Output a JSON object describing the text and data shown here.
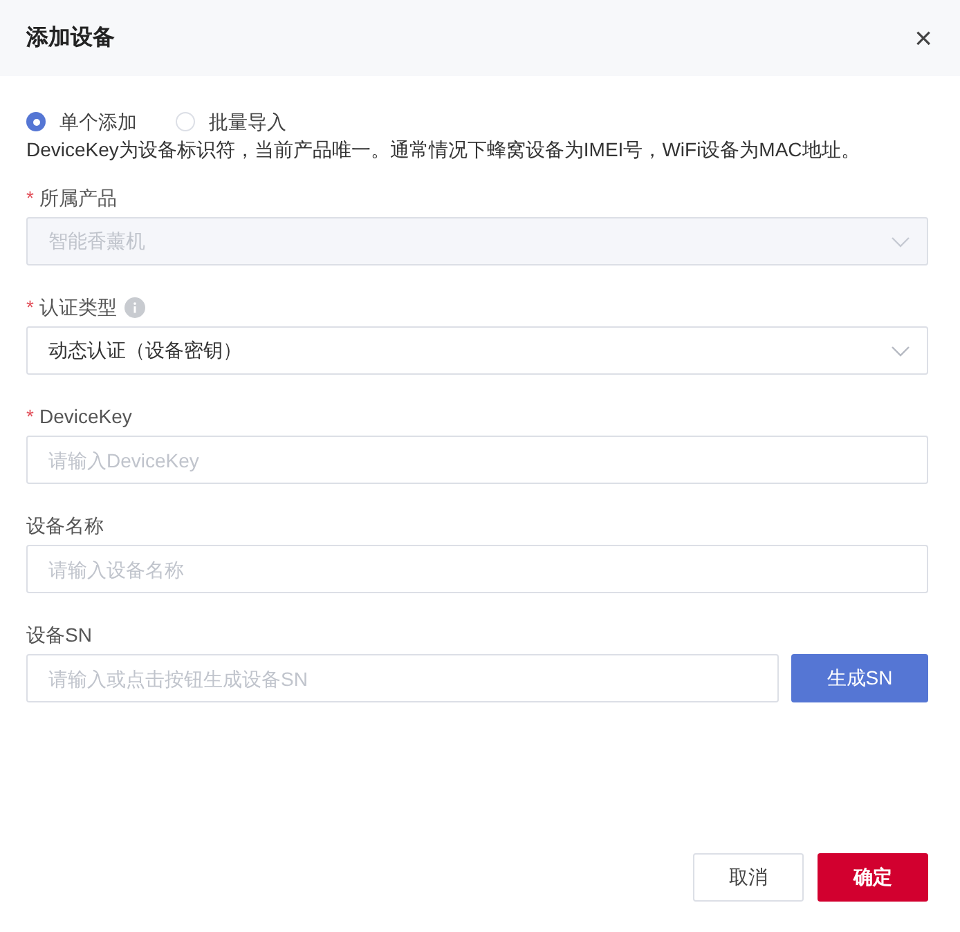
{
  "dialog": {
    "title": "添加设备",
    "close": "×"
  },
  "modes": [
    {
      "label": "单个添加",
      "selected": true
    },
    {
      "label": "批量导入",
      "selected": false
    }
  ],
  "description": "DeviceKey为设备标识符，当前产品唯一。通常情况下蜂窝设备为IMEI号，WiFi设备为MAC地址。",
  "fields": [
    {
      "kind": "select",
      "required_mark": "*",
      "label": "所属产品",
      "info": false,
      "value": "智能香薰机",
      "disabled": true
    },
    {
      "kind": "select",
      "required_mark": "*",
      "label": "认证类型",
      "info": true,
      "value": "动态认证（设备密钥）",
      "disabled": false
    },
    {
      "kind": "input",
      "required_mark": "*",
      "label": "DeviceKey",
      "info": false,
      "placeholder": "请输入DeviceKey"
    },
    {
      "kind": "input",
      "label": "设备名称",
      "info": false,
      "placeholder": "请输入设备名称"
    },
    {
      "kind": "input_button",
      "label": "设备SN",
      "info": false,
      "placeholder": "请输入或点击按钮生成设备SN",
      "button": "生成SN"
    }
  ],
  "buttons": {
    "cancel": "取消",
    "confirm": "确定"
  }
}
